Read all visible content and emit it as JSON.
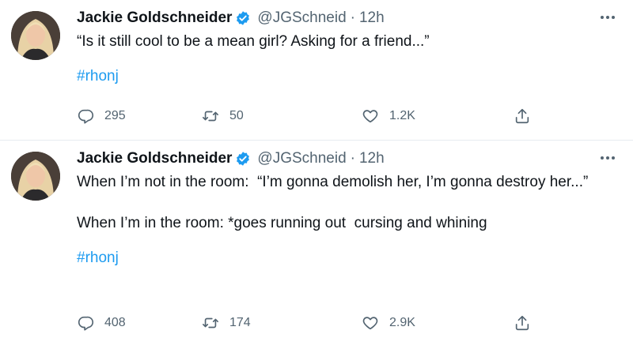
{
  "tweets": [
    {
      "author_name": "Jackie Goldschneider",
      "handle": "@JGSchneid",
      "separator": "·",
      "time": "12h",
      "text": "“Is it still cool to be a mean girl? Asking for a friend...”",
      "hashtag": "#rhonj",
      "replies": "295",
      "retweets": "50",
      "likes": "1.2K"
    },
    {
      "author_name": "Jackie Goldschneider",
      "handle": "@JGSchneid",
      "separator": "·",
      "time": "12h",
      "text": "When I’m not in the room:  “I’m gonna demolish her, I’m gonna destroy her...”\n\nWhen I’m in the room: *goes running out  cursing and whining",
      "hashtag": "#rhonj",
      "replies": "408",
      "retweets": "174",
      "likes": "2.9K"
    }
  ],
  "colors": {
    "text": "#0f1419",
    "secondary": "#536471",
    "accent": "#1d9bf0",
    "divider": "#e6ecf0"
  },
  "icons": [
    "avatar-photo",
    "verified-badge-icon",
    "more-icon",
    "reply-icon",
    "retweet-icon",
    "like-icon",
    "share-icon"
  ]
}
